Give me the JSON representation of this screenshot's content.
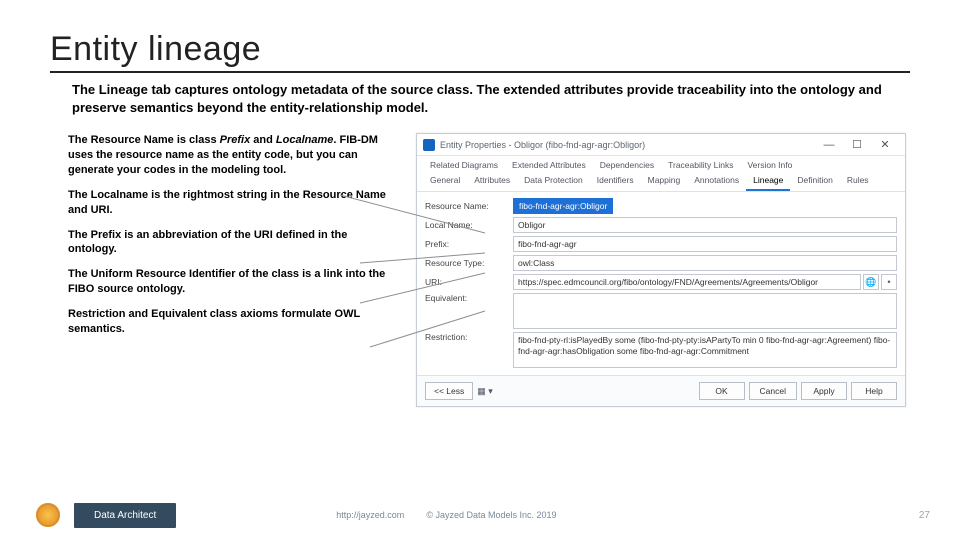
{
  "title": "Entity lineage",
  "subtitle": "The Lineage tab captures ontology metadata of the source class. The extended attributes provide traceability into the ontology and preserve semantics beyond the entity-relationship model.",
  "paragraphs": {
    "p1a": "The Resource Name is class ",
    "p1b": "Prefix",
    "p1c": " and ",
    "p1d": "Localname",
    "p1e": ". FIB-DM uses the resource name as the entity code, but you can generate your codes in the modeling tool.",
    "p2": "The Localname is the rightmost string in the Resource Name and URI.",
    "p3": "The Prefix is an abbreviation of the URI defined in the ontology.",
    "p4": "The Uniform Resource Identifier of the class is a link into the FIBO source ontology.",
    "p5": "Restriction and Equivalent class axioms formulate OWL semantics."
  },
  "dialog": {
    "title": "Entity Properties - Obligor (fibo-fnd-agr-agr:Obligor)",
    "tabs_top": [
      "Related Diagrams",
      "Extended Attributes",
      "Dependencies",
      "Traceability Links",
      "Version Info"
    ],
    "tabs_bottom": [
      "General",
      "Attributes",
      "Data Protection",
      "Identifiers",
      "Mapping",
      "Annotations",
      "Lineage",
      "Definition",
      "Rules"
    ],
    "active_tab": "Lineage",
    "fields": {
      "resource_name_lbl": "Resource Name:",
      "resource_name_val": "fibo-fnd-agr-agr:Obligor",
      "local_name_lbl": "Local Name:",
      "local_name_val": "Obligor",
      "prefix_lbl": "Prefix:",
      "prefix_val": "fibo-fnd-agr-agr",
      "resource_type_lbl": "Resource Type:",
      "resource_type_val": "owl:Class",
      "uri_lbl": "URI:",
      "uri_val": "https://spec.edmcouncil.org/fibo/ontology/FND/Agreements/Agreements/Obligor",
      "equivalent_lbl": "Equivalent:",
      "equivalent_val": "",
      "restriction_lbl": "Restriction:",
      "restriction_val": "fibo-fnd-pty-rl:isPlayedBy some (fibo-fnd-pty-pty:isAPartyTo min 0 fibo-fnd-agr-agr:Agreement)\nfibo-fnd-agr-agr:hasObligation some fibo-fnd-agr-agr:Commitment"
    },
    "buttons": {
      "less": "<< Less",
      "ok": "OK",
      "cancel": "Cancel",
      "apply": "Apply",
      "help": "Help"
    },
    "winbtns": {
      "min": "—",
      "max": "☐",
      "close": "✕"
    }
  },
  "footer": {
    "role": "Data Architect",
    "link": "http://jayzed.com",
    "copy": "© Jayzed Data Models Inc. 2019",
    "page": "27"
  }
}
